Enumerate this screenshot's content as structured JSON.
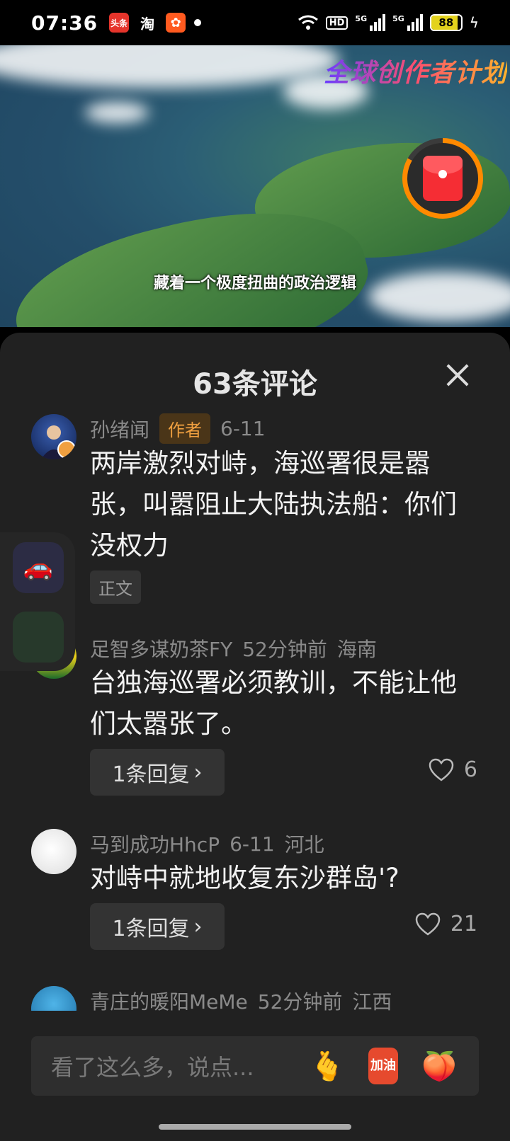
{
  "status_bar": {
    "time": "07:36",
    "app_icons": [
      "toutiao-icon",
      "taobao-icon",
      "kuaishou-icon"
    ],
    "app_labels": {
      "toutiao": "头条",
      "taobao": "淘"
    },
    "hd": "HD",
    "net1": "5G",
    "net2": "5G",
    "battery": "88",
    "battery_level": 0.88
  },
  "video": {
    "brand_text": "全球创作者计划",
    "subtitle": "藏着一个极度扭曲的政治逻辑"
  },
  "panel": {
    "title": "63条评论"
  },
  "comments": [
    {
      "user": "孙绪闻",
      "tag": "作者",
      "time": "6-11",
      "location": "",
      "text": "两岸激烈对峙，海巡署很是嚣张，叫嚣阻止大陆执法船：你们没权力",
      "chip": "正文"
    },
    {
      "user": "足智多谋奶茶FY",
      "time": "52分钟前",
      "location": "海南",
      "text": "台独海巡署必须教训，不能让他们太嚣张了。",
      "reply_label": "1条回复",
      "likes": "6"
    },
    {
      "user": "马到成功HhcP",
      "time": "6-11",
      "location": "河北",
      "text": "对峙中就地收复东沙群岛'?",
      "reply_label": "1条回复",
      "likes": "21"
    },
    {
      "user": "青庄的暖阳MeMe",
      "time": "52分钟前",
      "location": "江西"
    }
  ],
  "input": {
    "placeholder": "看了这么多，说点...",
    "emojis": [
      "finger-heart-icon",
      "jiayou-icon",
      "peach-icon"
    ],
    "jiayou_label": "加油"
  },
  "colors": {
    "panel_bg": "#212121",
    "author_tag": "#f0a040",
    "meta_gray": "#8a8a8a"
  }
}
